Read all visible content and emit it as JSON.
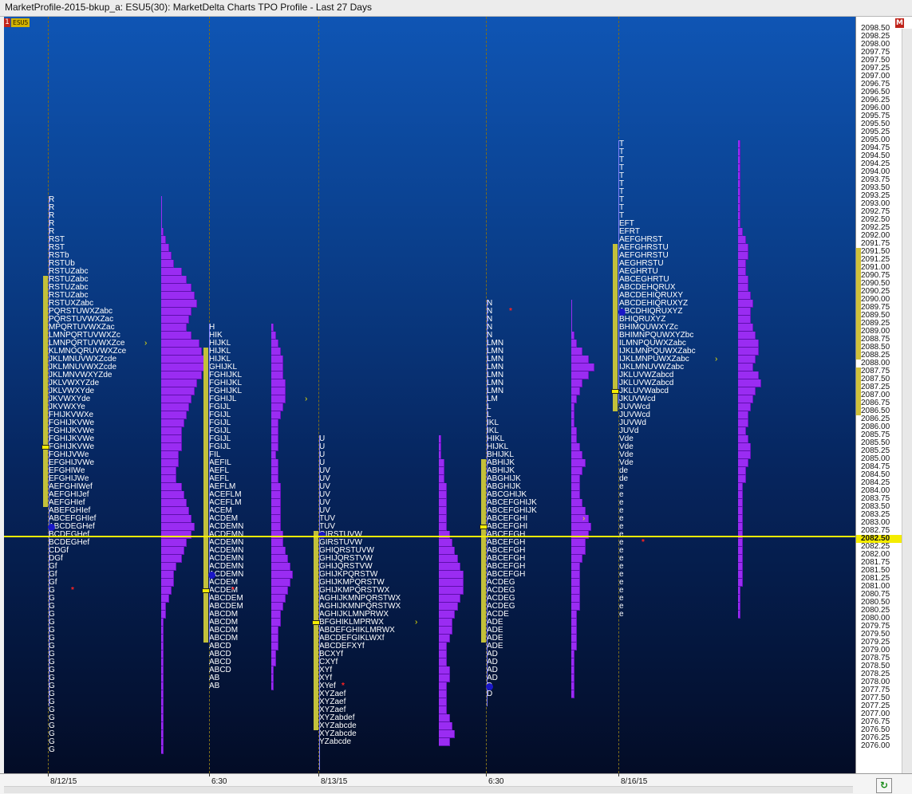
{
  "window": {
    "title": "MarketProfile-2015-bkup_a: ESU5(30): MarketDelta Charts TPO Profile - Last 27 Days"
  },
  "chart": {
    "indicator": "1",
    "symbol": "ESU5",
    "last_price": "2082.50",
    "axis_marker": "M",
    "refresh_icon": "refresh-icon"
  },
  "colors": {
    "bar": "#9a2cf2",
    "value_area": "#c3c03a",
    "last_price_line": "#f4ec00",
    "poc_marker": "#f4ec00",
    "open_marker": "#1b18c8",
    "arrow": "#f4ec00",
    "star": "#ff2222"
  },
  "axis": {
    "top": 2098.5,
    "step": 0.25,
    "count": 91,
    "value_area_prices": [
      "2091.50",
      "2091.25",
      "2091.00",
      "2090.75",
      "2090.50",
      "2090.25",
      "2090.00",
      "2089.75",
      "2089.50",
      "2089.25",
      "2089.00",
      "2088.75",
      "2088.50",
      "2088.25",
      "2087.75",
      "2087.50",
      "2087.25",
      "2087.00",
      "2086.75",
      "2086.50"
    ]
  },
  "x_labels": [
    {
      "text": "8/12/15"
    },
    {
      "text": "6:30"
    },
    {
      "text": "8/13/15"
    },
    {
      "text": "6:30"
    },
    {
      "text": "8/16/15"
    }
  ],
  "profiles": [
    {
      "top_price": 2093.0,
      "rows": [
        "R",
        "R",
        "R",
        "R",
        "R",
        "RST",
        "RST",
        "RSTb",
        "RSTUb",
        "RSTUZabc",
        "RSTUZabc",
        "RSTUZabc",
        "RSTUZabc",
        "RSTUXZabc",
        "PQRSTUWXZabc",
        "PQRSTUVWXZac",
        "MPQRTUVWXZac",
        "LMNPQRTUVWXZc",
        "LMNPQRTUVWXZce",
        "KLMNOQRUVWXZce",
        "JKLMNUVWXZcde",
        "JKLMNUVWXZcde",
        "JKLMNVWXYZde",
        "JKLVWXYZde",
        "JKLVWXYde",
        "JKVWXYde",
        "JKVWXYe",
        "FHIJKVWXe",
        "FGHIJKVWe",
        "FGHIJKVWe",
        "FGHIJKVWe",
        "FGHIJKVWe",
        "FGHIJVWe",
        "EFGHIJVWe",
        "EFGHIWe",
        "EFGHIJWe",
        "AEFGHIWef",
        "AEFGHIJef",
        "AEFGHIef",
        "ABEFGHIef",
        "ABCEFGHIef",
        "ABCDEGHef",
        "BCDEGHef",
        "BCDEGHef",
        "CDGf",
        "DGf",
        "Gf",
        "Gf",
        "Gf",
        "G",
        "G",
        "G",
        "G",
        "G",
        "G",
        "G",
        "G",
        "G",
        "G",
        "G",
        "G",
        "G",
        "G",
        "G",
        "G",
        "G",
        "G",
        "G",
        "G",
        "G"
      ],
      "bars": [
        0,
        0,
        0,
        0,
        1,
        2,
        3,
        4,
        5,
        8,
        10,
        12,
        13,
        14,
        12,
        11,
        10,
        12,
        15,
        16,
        17,
        18,
        16,
        14,
        13,
        12,
        11,
        10,
        9,
        8,
        8,
        8,
        7,
        7,
        6,
        6,
        8,
        9,
        10,
        11,
        12,
        13,
        12,
        10,
        9,
        8,
        6,
        5,
        5,
        4,
        3,
        2,
        2,
        1,
        1,
        1,
        1,
        1,
        1,
        1,
        1,
        1,
        1,
        1,
        1,
        1,
        1,
        1,
        1,
        1
      ],
      "va": [
        2090.5,
        2083.5
      ],
      "poc_price": 2085.25,
      "open_price": 2082.75,
      "ib_low": 2077.0,
      "arrow_price": 2088.5,
      "star_price": 2080.75
    },
    {
      "top_price": 2089.0,
      "rows": [
        "H",
        "HIK",
        "HIJKL",
        "HIJKL",
        "HIJKL",
        "GHIJKL",
        "FGHIJKL",
        "FGHIJKL",
        "FGHIJKL",
        "FGHIJL",
        "FGIJL",
        "FGIJL",
        "FGIJL",
        "FGIJL",
        "FGIJL",
        "FGIJL",
        "FIL",
        "AEFIL",
        "AEFL",
        "AEFL",
        "AEFLM",
        "ACEFLM",
        "ACEFLM",
        "ACEM",
        "ACDEM",
        "ACDEMN",
        "ACDEMN",
        "ACDEMN",
        "ACDEMN",
        "ACDEMN",
        "ACDEMN",
        "ACDEMN",
        "ACDEM",
        "ACDEM",
        "ABCDEM",
        "ABCDEM",
        "ABCDM",
        "ABCDM",
        "ABCDM",
        "ABCDM",
        "ABCD",
        "ABCD",
        "ABCD",
        "ABCD",
        "AB",
        "AB"
      ],
      "bars": [
        1,
        2,
        3,
        4,
        5,
        5,
        5,
        6,
        6,
        6,
        5,
        4,
        3,
        3,
        3,
        3,
        2,
        3,
        3,
        3,
        4,
        4,
        4,
        4,
        4,
        4,
        5,
        5,
        6,
        7,
        8,
        9,
        8,
        7,
        6,
        5,
        4,
        4,
        3,
        3,
        3,
        2,
        2,
        1,
        1,
        1
      ],
      "va": [
        2088.25,
        2079.25
      ],
      "poc_price": 2080.75,
      "open_price": 2081.25,
      "ib_low": 2079.0,
      "arrow_price": 2086.75,
      "star_price": 2080.75
    },
    {
      "top_price": 2085.5,
      "rows": [
        "U",
        "U",
        "U",
        "U",
        "UV",
        "UV",
        "UV",
        "UV",
        "UV",
        "UV",
        "TUV",
        "TUV",
        "GIRSTUVW",
        "GIRSTUVW",
        "GHIQRSTUVW",
        "GHIJQRSTVW",
        "GHIJQRSTVW",
        "GHIJKPQRSTW",
        "GHIJKMPQRSTW",
        "GHIJKMPQRSTWX",
        "AGHIJKMNPQRSTWX",
        "AGHIJKMNPQRSTWX",
        "AGHIJKLMNPRWX",
        "BFGHIKLMPRWX",
        "ABDEFGHIKLMRWX",
        "ABCDEFGIKLWXf",
        "ABCDEFXYf",
        "BCXYf",
        "CXYf",
        "XYf",
        "XYf",
        "XYef",
        "XYZaef",
        "XYZaef",
        "XYZaef",
        "XYZabdef",
        "XYZabcde",
        "XYZabcde",
        "YZabcde"
      ],
      "bars": [
        1,
        1,
        1,
        2,
        2,
        2,
        3,
        3,
        3,
        3,
        3,
        3,
        4,
        5,
        6,
        7,
        8,
        9,
        9,
        9,
        8,
        7,
        6,
        5,
        5,
        4,
        3,
        3,
        3,
        4,
        4,
        3,
        3,
        3,
        3,
        4,
        5,
        6,
        4
      ],
      "va": [
        2082.5,
        2076.5
      ],
      "poc_price": 2079.75,
      "open_price": 2082.5,
      "ib_low": 2075.0,
      "arrow_price": 2079.75,
      "star_price": 2077.75
    },
    {
      "top_price": 2089.75,
      "rows": [
        "N",
        "N",
        "N",
        "N",
        "N",
        "LMN",
        "LMN",
        "LMN",
        "LMN",
        "LMN",
        "LMN",
        "LMN",
        "LM",
        "L",
        "L",
        "IKL",
        "IKL",
        "HIKL",
        "HIJKL",
        "BHIJKL",
        "ABHIJK",
        "ABHIJK",
        "ABGHIJK",
        "ABGHIJK",
        "ABCGHIJK",
        "ABCEFGHIJK",
        "ABCEFGHIJK",
        "ABCEFGHI",
        "ABCEFGHI",
        "ABCEFGH",
        "ABCEFGH",
        "ABCEFGH",
        "ABCEFGH",
        "ABCEFGH",
        "ABCEFGH",
        "ACDEG",
        "ACDEG",
        "ACDEG",
        "ACDEG",
        "ACDE",
        "ADE",
        "ADE",
        "ADE",
        "ADE",
        "AD",
        "AD",
        "AD",
        "AD",
        "D",
        "D"
      ],
      "bars": [
        0,
        0,
        0,
        0,
        1,
        2,
        4,
        6,
        8,
        6,
        4,
        3,
        2,
        1,
        1,
        1,
        2,
        2,
        3,
        4,
        5,
        4,
        3,
        3,
        3,
        4,
        5,
        6,
        7,
        6,
        5,
        5,
        4,
        3,
        3,
        3,
        3,
        3,
        3,
        2,
        2,
        2,
        2,
        2,
        1,
        1,
        1,
        1,
        1,
        1
      ],
      "va": [
        2084.75,
        2079.25
      ],
      "poc_price": 2082.75,
      "open_price": 2077.75,
      "ib_low": 2077.0,
      "arrow_price": 2083.0,
      "star_price": 2089.5
    },
    {
      "top_price": 2094.75,
      "rows": [
        "T",
        "T",
        "T",
        "T",
        "T",
        "T",
        "T",
        "T",
        "T",
        "T",
        "EFT",
        "EFRT",
        "AEFGHRST",
        "AEFGHRSTU",
        "AEFGHRSTU",
        "AEGHRSTU",
        "AEGHRTU",
        "ABCEGHRTU",
        "ABCDEHQRUX",
        "ABCDEHIQRUXY",
        "ABCDEHIQRUXYZ",
        "ABCDHIQRUXYZ",
        "BHIQRUXYZ",
        "BHIMQUWXYZc",
        "BHIMNPQUWXYZbc",
        "ILMNPQUWXZabc",
        "IJKLMNPQUWXZabc",
        "IJKLMNPUWXZabc",
        "IJKLMNUVWZabc",
        "JKLUVWZabcd",
        "JKLUVWZabcd",
        "JKLUVWabcd",
        "JKUVWcd",
        "JUVWcd",
        "JUVWcd",
        "JUVWd",
        "JUVd",
        "Vde",
        "Vde",
        "Vde",
        "Vde",
        "de",
        "de",
        "e",
        "e",
        "e",
        "e",
        "e",
        "e",
        "e",
        "e",
        "e",
        "e",
        "e",
        "e",
        "e",
        "e",
        "e",
        "e",
        "e"
      ],
      "bars": [
        1,
        1,
        1,
        1,
        1,
        1,
        1,
        1,
        1,
        1,
        1,
        2,
        3,
        4,
        4,
        3,
        3,
        4,
        4,
        5,
        6,
        5,
        5,
        6,
        7,
        8,
        8,
        7,
        6,
        8,
        9,
        7,
        6,
        5,
        4,
        4,
        3,
        4,
        5,
        5,
        4,
        3,
        3,
        2,
        2,
        2,
        2,
        2,
        2,
        2,
        2,
        2,
        2,
        2,
        2,
        2,
        1,
        1,
        1,
        1
      ],
      "va": [
        2091.5,
        2086.5
      ],
      "poc_price": 2087.0,
      "open_price": 2089.5,
      "ib_low": 2086.5,
      "arrow_price": 2088.0,
      "star_price": 2082.25
    }
  ]
}
